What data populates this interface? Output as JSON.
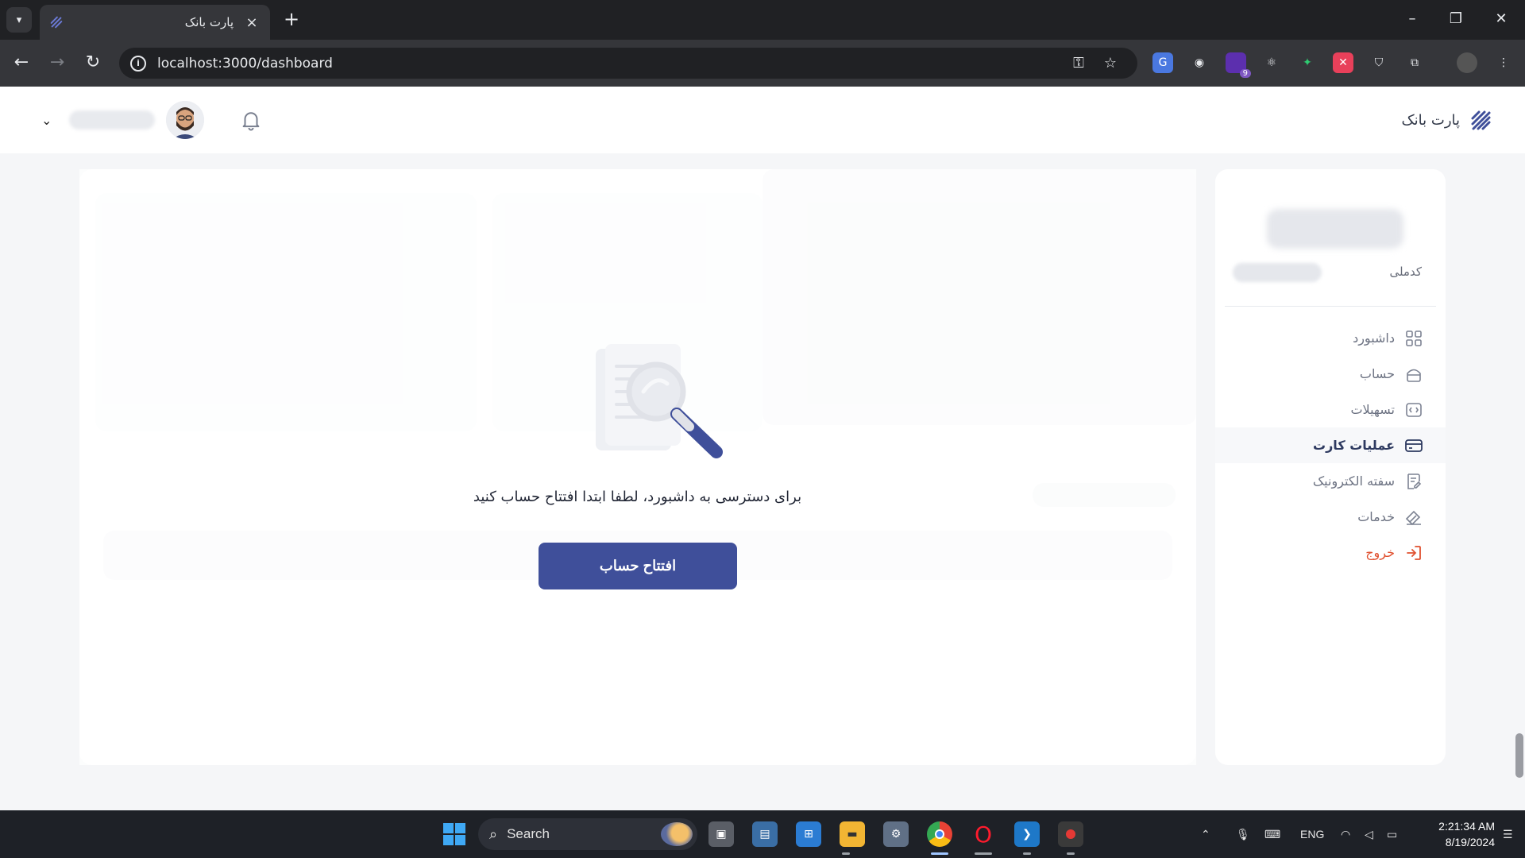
{
  "browser": {
    "tab_title": "پارت بانک",
    "url": "localhost:3000/dashboard",
    "extension_badge": "9"
  },
  "header": {
    "brand_name": "پارت بانک"
  },
  "sidebar": {
    "national_id_label": "کدملی",
    "menu": [
      {
        "label": "داشبورد",
        "icon": "dashboard-icon"
      },
      {
        "label": "حساب",
        "icon": "wallet-icon"
      },
      {
        "label": "تسهیلات",
        "icon": "loan-icon"
      },
      {
        "label": "عملیات کارت",
        "icon": "card-icon"
      },
      {
        "label": "سفته الکترونیک",
        "icon": "document-edit-icon"
      },
      {
        "label": "خدمات",
        "icon": "services-icon"
      },
      {
        "label": "خروج",
        "icon": "logout-icon"
      }
    ],
    "active_index": 3
  },
  "main": {
    "empty_message": "برای دسترسی به داشبورد، لطفا ابتدا افتتاح حساب کنید",
    "open_account_button": "افتتاح حساب"
  },
  "taskbar": {
    "search_placeholder": "Search",
    "language": "ENG",
    "time": "2:21:34 AM",
    "date": "8/19/2024"
  },
  "colors": {
    "primary": "#3f4f9a",
    "logout": "#e0502f",
    "active_text": "#2e3a60"
  }
}
